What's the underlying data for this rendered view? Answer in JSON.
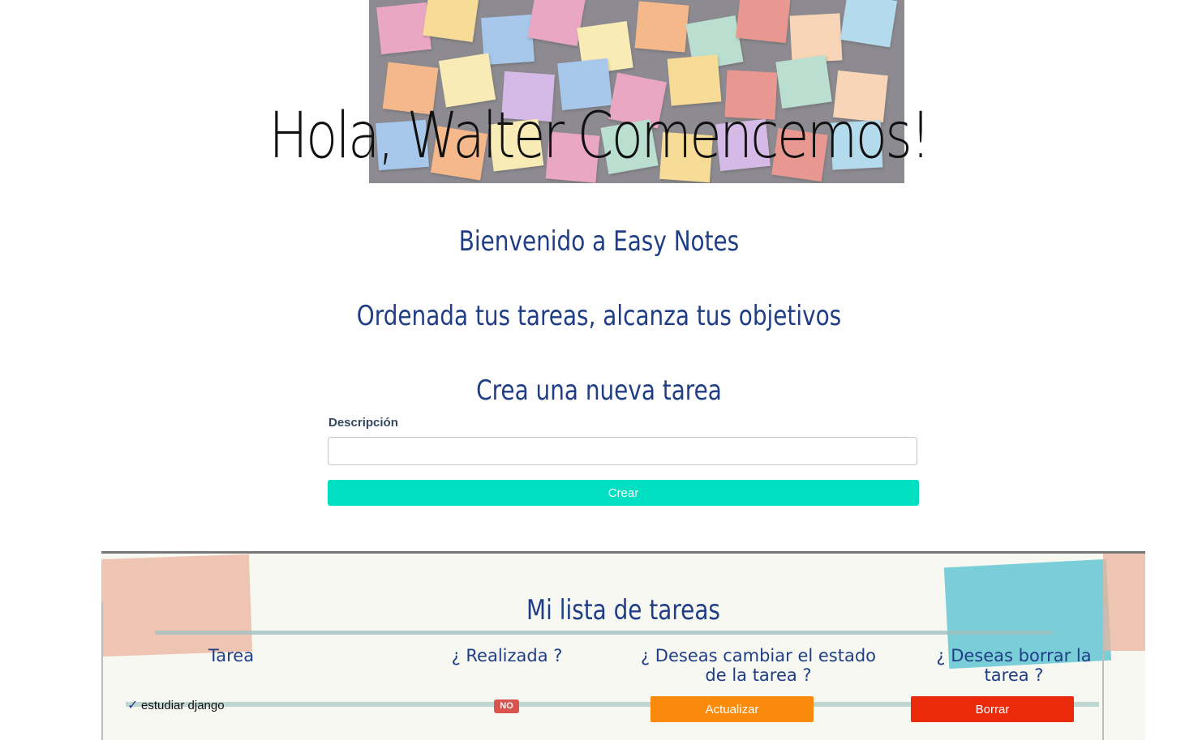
{
  "hero": {
    "title": "Hola, Walter Comencemos!",
    "note_colors": [
      "#e58fb2",
      "#f4d27a",
      "#8fb9e6",
      "#f2a46a",
      "#f7e6a0",
      "#a7d7c5",
      "#e27b73",
      "#c9a7e1",
      "#f6c9a3",
      "#9ed0e8"
    ]
  },
  "intro": {
    "welcome": "Bienvenido a Easy Notes",
    "tagline": "Ordenada tus tareas, alcanza tus objetivos",
    "create_heading": "Crea una nueva tarea"
  },
  "form": {
    "description_label": "Descripción",
    "description_value": "",
    "create_button": "Crear"
  },
  "task_list": {
    "title": "Mi lista de tareas",
    "columns": {
      "task": "Tarea",
      "done": "¿ Realizada ?",
      "change_state": "¿ Deseas cambiar el estado de la tarea ?",
      "delete": "¿ Deseas borrar la tarea ?"
    },
    "tasks": [
      {
        "check_icon": "✓",
        "name": "estudiar django",
        "done_badge": "NO",
        "update_button": "Actualizar",
        "delete_button": "Borrar"
      }
    ]
  },
  "colors": {
    "heading": "#1f3e86",
    "create_button": "#00dfc1",
    "update_button": "#f98a0c",
    "delete_button": "#ea2a0a",
    "badge_no": "#d9534f"
  }
}
